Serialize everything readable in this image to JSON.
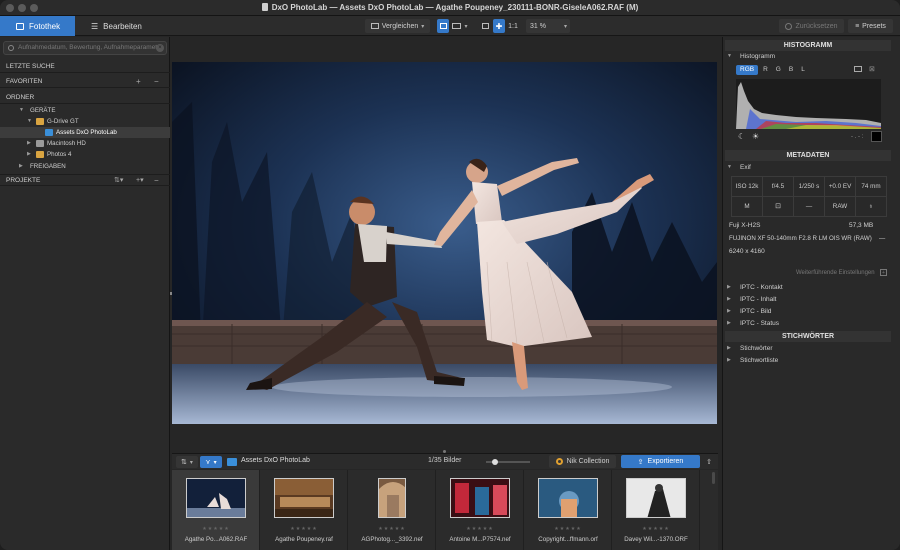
{
  "window": {
    "title": "DxO PhotoLab — Assets DxO PhotoLab — Agathe Poupeney_230111-BONR-GiseleA062.RAF (M)"
  },
  "tabs": [
    {
      "label": "Fotothek",
      "icon": "library-icon"
    },
    {
      "label": "Bearbeiten",
      "icon": "sliders-icon"
    }
  ],
  "toolbar": {
    "compare_label": "Vergleichen",
    "one_to_one_label": "1:1",
    "zoom_value": "31 %",
    "reset_label": "Zurücksetzen",
    "presets_label": "Presets"
  },
  "left": {
    "search_placeholder": "Aufnahmedatum, Bewertung, Aufnahmeparameter",
    "recent_search": "LETZTE SUCHE",
    "favorites": "FAVORITEN",
    "folders": "ORDNER",
    "devices": "GERÄTE",
    "items": [
      {
        "label": "G-Drive GT"
      },
      {
        "label": "Assets DxO PhotoLab"
      },
      {
        "label": "Macintosh HD"
      },
      {
        "label": "Photos 4"
      }
    ],
    "shares": "FREIGABEN",
    "projects": "PROJEKTE"
  },
  "filmstrip": {
    "folder": "Assets DxO PhotoLab",
    "count": "1/35 Bilder",
    "nik_label": "Nik Collection",
    "export_label": "Exportieren",
    "slider_value": 0.15,
    "thumbs": [
      {
        "name": "Agathe Po...A062.RAF",
        "stars": "★★★★★"
      },
      {
        "name": "Agathe Poupeney.raf",
        "stars": "★★★★★"
      },
      {
        "name": "AGPhotog..._3392.nef",
        "stars": "★★★★★"
      },
      {
        "name": "Antoine M...P7574.nef",
        "stars": "★★★★★"
      },
      {
        "name": "Copyright...ffmann.orf",
        "stars": "★★★★★"
      },
      {
        "name": "Davey Wil...-1370.ORF",
        "stars": "★★★★★"
      }
    ]
  },
  "right": {
    "histogram_header": "HISTOGRAMM",
    "histogram_label": "Histogramm",
    "channels": [
      "RGB",
      "R",
      "G",
      "B",
      "L"
    ],
    "metadata_header": "METADATEN",
    "exif_label": "Exif",
    "exif_row1": [
      "ISO 12k",
      "f/4.5",
      "1/250 s",
      "+0.0 EV",
      "74 mm"
    ],
    "exif_row2": [
      "M",
      "",
      "—",
      "RAW",
      ""
    ],
    "camera": "Fuji X-H2S",
    "filesize": "57,3 MB",
    "lens": "FUJINON XF 50-140mm F2.8 R LM OIS WR (RAW)",
    "lens_more": "—",
    "dimensions": "6240 x 4160",
    "more_settings": "Weiterführende Einstellungen",
    "iptc": [
      "IPTC - Kontakt",
      "IPTC - Inhalt",
      "IPTC - Bild",
      "IPTC - Status"
    ],
    "keywords_header": "STICHWÖRTER",
    "keywords": [
      "Stichwörter",
      "Stichwortliste"
    ],
    "hist_extra": "- . - :"
  }
}
